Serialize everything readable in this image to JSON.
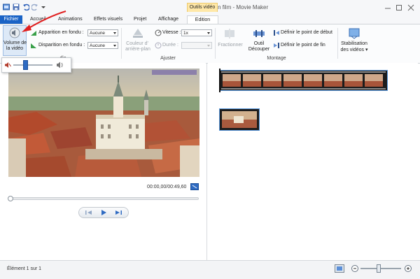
{
  "window": {
    "title": "Mon film - Movie Maker"
  },
  "tabs": {
    "fichier": "Fichier",
    "items": [
      "Accueil",
      "Animations",
      "Effets visuels",
      "Projet",
      "Affichage"
    ],
    "contextual_group": "Outils vidéo",
    "edition": "Edition"
  },
  "ribbon": {
    "volume_button": {
      "line1": "Volume de",
      "line2": "la vidéo"
    },
    "fade_in": {
      "label": "Apparition en fondu :",
      "value": "Aucune"
    },
    "fade_out": {
      "label": "Disparition en fondu :",
      "value": "Aucune"
    },
    "background_color": {
      "line1": "Couleur d'",
      "line2": "arrière-plan"
    },
    "speed": {
      "label": "Vitesse :",
      "value": "1x"
    },
    "duration": {
      "label": "Durée :"
    },
    "split": "Fractionner",
    "trim_tool": {
      "line1": "Outil",
      "line2": "Découper"
    },
    "set_start": "Définir le point de début",
    "set_end": "Définir le point de fin",
    "stabilization": {
      "line1": "Stabilisation",
      "line2": "des vidéos"
    },
    "groups": {
      "audio": "dio",
      "adjust": "Ajuster",
      "edit": "Montage"
    }
  },
  "volume_popup": {
    "level": 0.3
  },
  "player": {
    "time": "00:00,00/00:49,60",
    "seek_position": 0.0
  },
  "status": {
    "text": "Élément 1 sur 1"
  },
  "zoom": {
    "level": 0.45
  },
  "colors": {
    "accent": "#1a63c6",
    "contextual": "#ffe8a8",
    "annotation": "#e02020"
  }
}
